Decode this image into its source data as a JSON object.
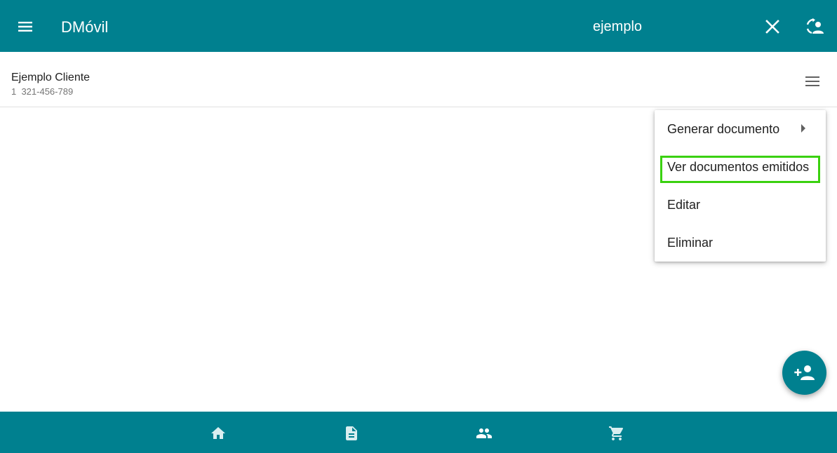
{
  "appbar": {
    "title": "DMóvil",
    "search_value": "ejemplo",
    "icons": {
      "menu": "menu-icon",
      "clear": "close-icon",
      "sync": "sync-user-icon"
    }
  },
  "client": {
    "name": "Ejemplo Cliente",
    "subtitle": "1  321-456-789",
    "menu_icon": "hamburger-icon"
  },
  "context_menu": {
    "items": [
      {
        "label": "Generar documento",
        "has_submenu": true
      },
      {
        "label": "Ver documentos emitidos",
        "highlighted": true
      },
      {
        "label": "Editar"
      },
      {
        "label": "Eliminar"
      }
    ],
    "highlight_color": "#3ad10f"
  },
  "fab": {
    "icon": "person-add-icon"
  },
  "bottom_nav": {
    "items": [
      {
        "icon": "home-icon"
      },
      {
        "icon": "document-icon"
      },
      {
        "icon": "people-icon",
        "active": true
      },
      {
        "icon": "cart-icon"
      }
    ]
  },
  "colors": {
    "primary": "#00808f",
    "text": "#212121",
    "secondary_text": "#757575"
  }
}
